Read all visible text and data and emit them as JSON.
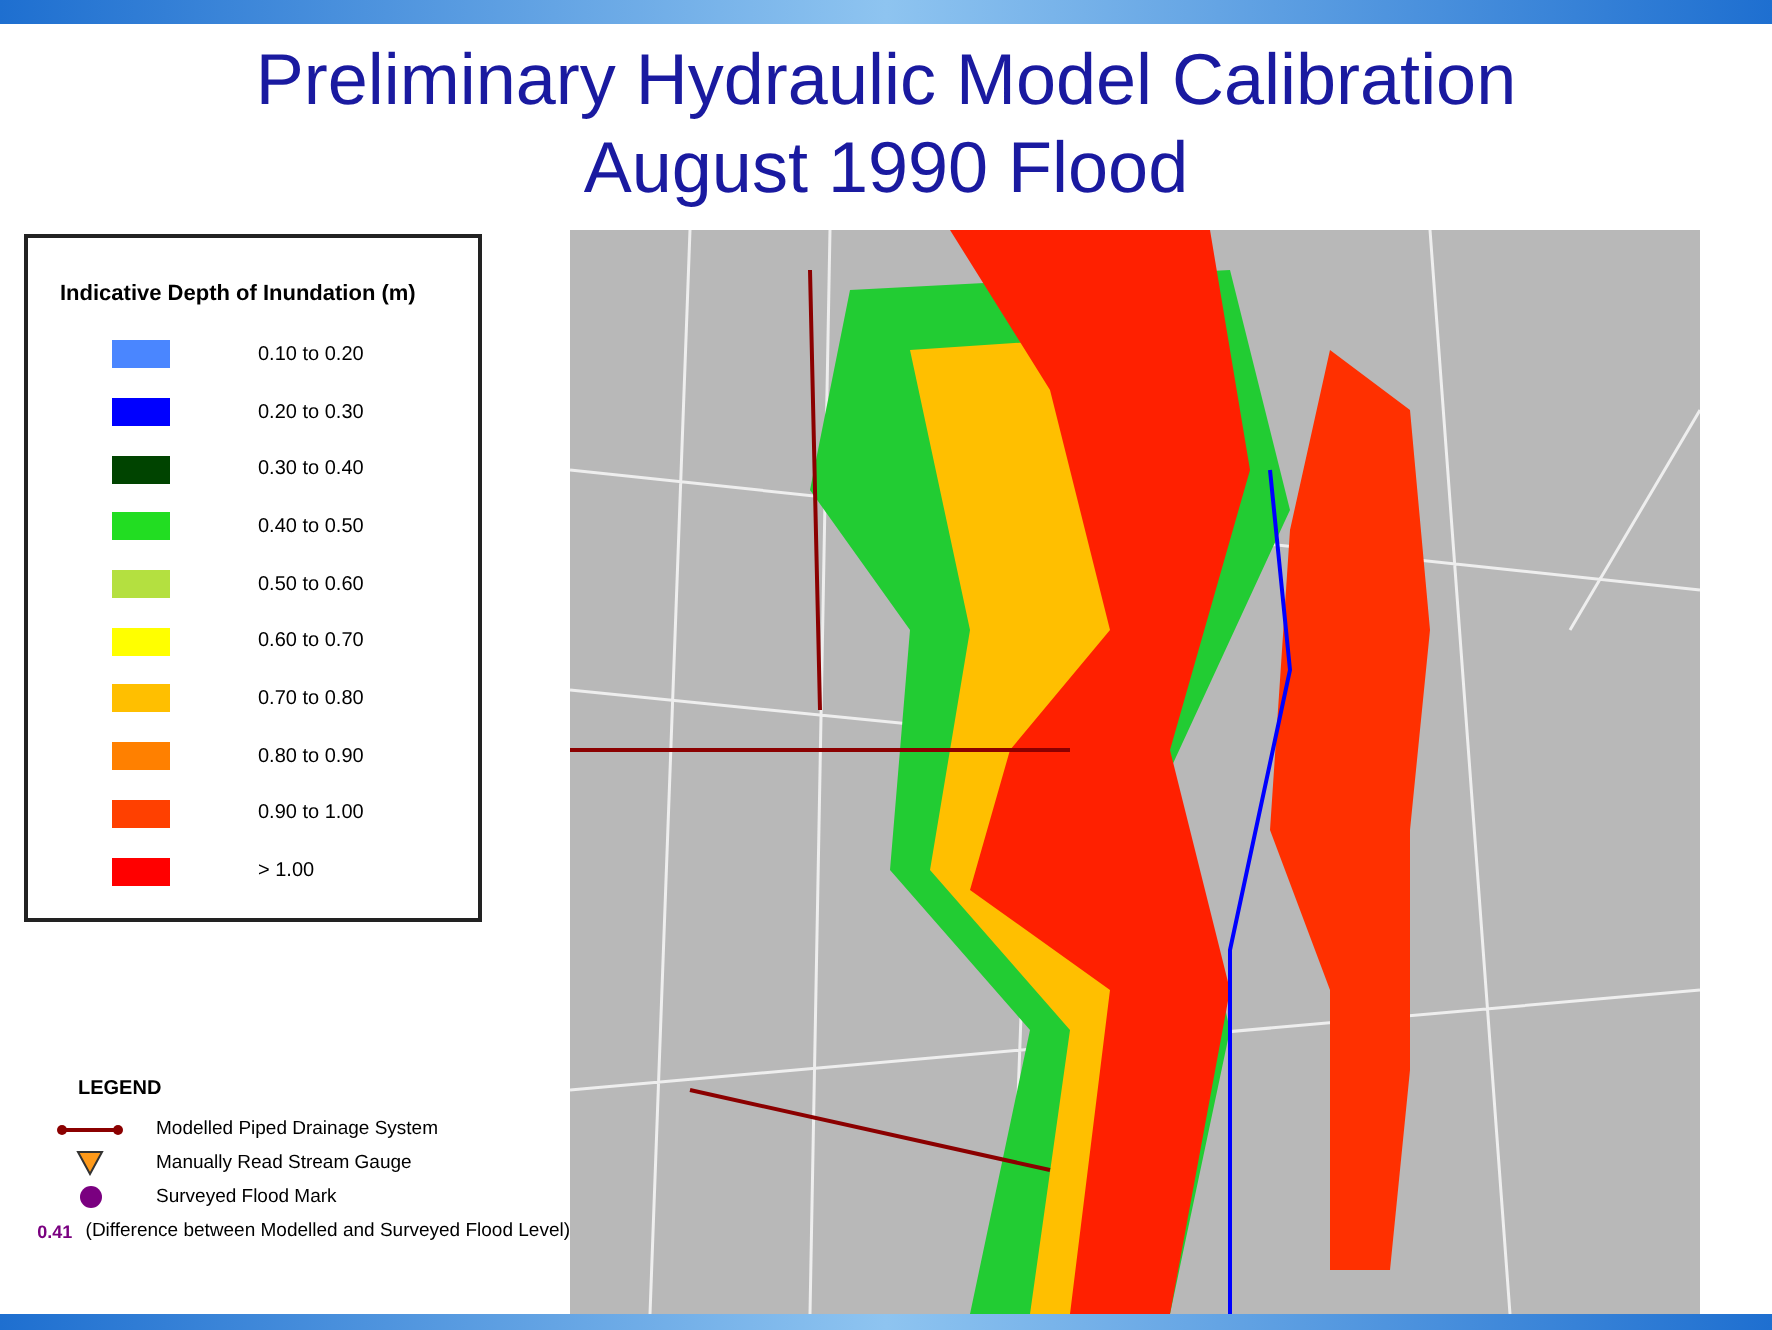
{
  "title": [
    "Preliminary Hydraulic Model Calibration",
    "August 1990 Flood"
  ],
  "depth_legend": {
    "title": "Indicative Depth of Inundation (m)",
    "items": [
      {
        "color": "#4a86ff",
        "label": "0.10 to 0.20"
      },
      {
        "color": "#0000ff",
        "label": "0.20 to 0.30"
      },
      {
        "color": "#004400",
        "label": "0.30 to 0.40"
      },
      {
        "color": "#22dd22",
        "label": "0.40 to 0.50"
      },
      {
        "color": "#b4e040",
        "label": "0.50 to 0.60"
      },
      {
        "color": "#ffff00",
        "label": "0.60 to 0.70"
      },
      {
        "color": "#ffbf00",
        "label": "0.70 to 0.80"
      },
      {
        "color": "#ff8000",
        "label": "0.80 to 0.90"
      },
      {
        "color": "#ff4000",
        "label": "0.90 to 1.00"
      },
      {
        "color": "#ff0000",
        "label": "> 1.00"
      }
    ]
  },
  "legend": {
    "title": "LEGEND",
    "items": [
      {
        "kind": "pipe",
        "label": "Modelled Piped Drainage System"
      },
      {
        "kind": "gauge",
        "label": "Manually Read Stream Gauge"
      },
      {
        "kind": "mark",
        "label": "Surveyed Flood Mark"
      },
      {
        "kind": "value",
        "symbol": "0.41",
        "label": "(Difference between Modelled and Surveyed Flood Level)"
      }
    ]
  }
}
